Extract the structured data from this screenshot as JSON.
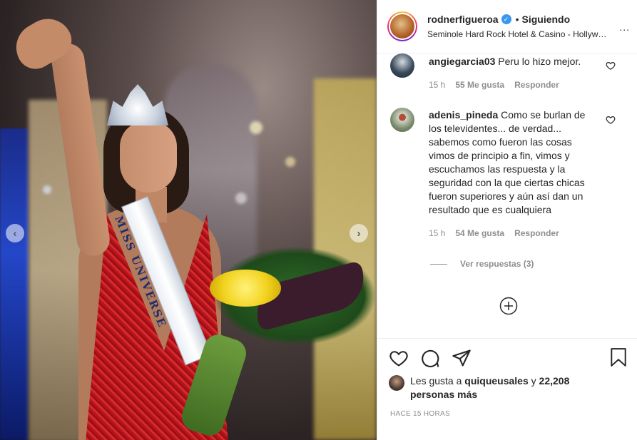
{
  "post": {
    "header": {
      "username": "rodnerfigueroa",
      "verified_mark": "✓",
      "separator": "•",
      "follow_status": "Siguiendo",
      "location": "Seminole Hard Rock Hotel & Casino - Hollyw…",
      "more_icon": "more-options-icon",
      "more_label": "..."
    },
    "photo": {
      "sash_text": "MISS UNIVERSE",
      "prev_icon": "chevron-left-icon",
      "next_icon": "chevron-right-icon",
      "prev_label": "‹",
      "next_label": "›"
    },
    "comments": [
      {
        "user": "angiegarcia03",
        "text": "Peru lo hizo mejor.",
        "time": "15 h",
        "likes": "55 Me gusta",
        "reply": "Responder",
        "avatar_color": "#3a4a5c"
      },
      {
        "user": "adenis_pineda",
        "text": "Como se burlan de los televidentes... de verdad... sabemos como fueron las cosas vimos de principio a fin, vimos y escuchamos las respuesta y la seguridad con la que ciertas chicas fueron superiores y aún así dan un resultado que es cualquiera",
        "time": "15 h",
        "likes": "54 Me gusta",
        "reply": "Responder",
        "avatar_color": "#7a8a6c"
      }
    ],
    "view_replies": "Ver respuestas (3)",
    "actions": {
      "like_icon": "heart-icon",
      "comment_icon": "comment-icon",
      "share_icon": "send-icon",
      "save_icon": "bookmark-icon"
    },
    "likes": {
      "prefix": "Les gusta a",
      "user": "quiqueusales",
      "conj": "y",
      "count": "22,208 personas más"
    },
    "timestamp": "HACE 15 HORAS"
  }
}
